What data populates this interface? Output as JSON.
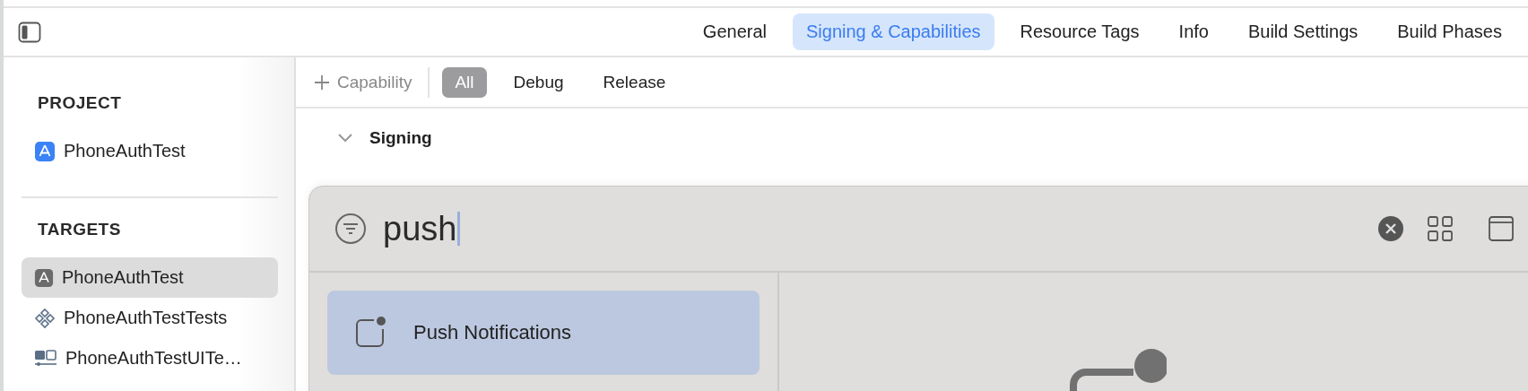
{
  "tabs": [
    {
      "label": "General",
      "selected": false
    },
    {
      "label": "Signing & Capabilities",
      "selected": true
    },
    {
      "label": "Resource Tags",
      "selected": false
    },
    {
      "label": "Info",
      "selected": false
    },
    {
      "label": "Build Settings",
      "selected": false
    },
    {
      "label": "Build Phases",
      "selected": false
    }
  ],
  "sidebar": {
    "sections": [
      {
        "title": "PROJECT",
        "items": [
          {
            "label": "PhoneAuthTest",
            "kind": "app",
            "selected": false
          }
        ]
      },
      {
        "title": "TARGETS",
        "items": [
          {
            "label": "PhoneAuthTest",
            "kind": "target",
            "selected": true
          },
          {
            "label": "PhoneAuthTestTests",
            "kind": "tests",
            "selected": false
          },
          {
            "label": "PhoneAuthTestUITe…",
            "kind": "uitests",
            "selected": false
          }
        ]
      }
    ]
  },
  "filter_bar": {
    "add_button": "Capability",
    "configs": [
      {
        "label": "All",
        "selected": true
      },
      {
        "label": "Debug",
        "selected": false
      },
      {
        "label": "Release",
        "selected": false
      }
    ]
  },
  "sections": [
    {
      "title": "Signing",
      "expanded": true
    }
  ],
  "library": {
    "search_value": "push",
    "results": [
      {
        "label": "Push Notifications",
        "selected": true
      }
    ]
  }
}
